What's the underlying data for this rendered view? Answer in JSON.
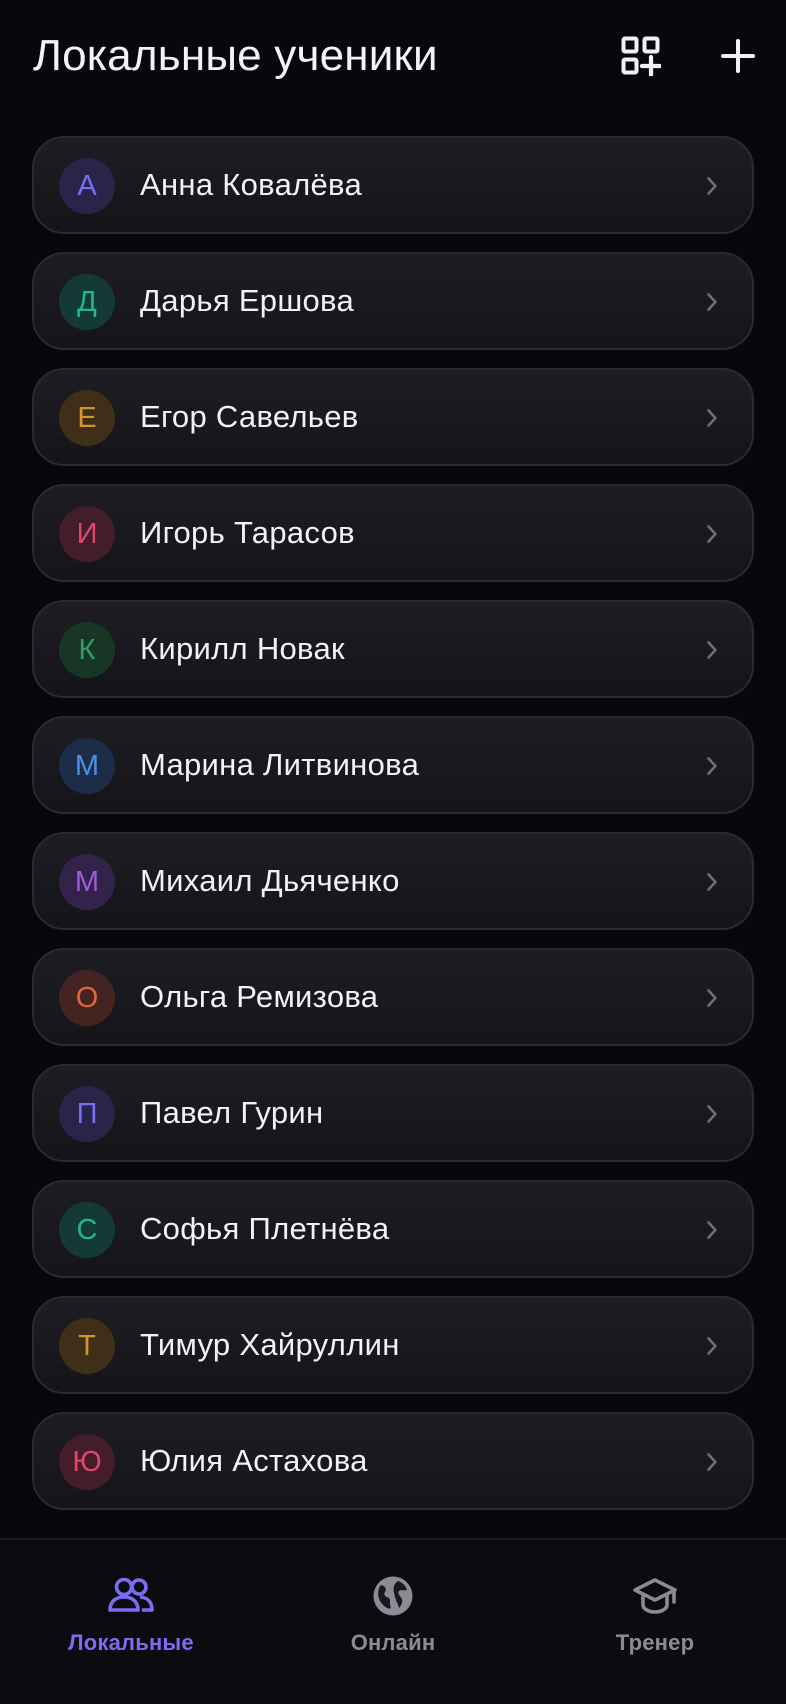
{
  "header": {
    "title": "Локальные ученики",
    "qr_icon": "qr-add-icon",
    "add_icon": "plus-icon"
  },
  "students": [
    {
      "initial": "А",
      "name": "Анна Ковалёва",
      "color": "#7c6cf0",
      "bg": "#29254a"
    },
    {
      "initial": "Д",
      "name": "Дарья Ершова",
      "color": "#1fb59a",
      "bg": "#143a35"
    },
    {
      "initial": "Е",
      "name": "Егор Савельев",
      "color": "#d4932c",
      "bg": "#3f2f18"
    },
    {
      "initial": "И",
      "name": "Игорь Тарасов",
      "color": "#e0466a",
      "bg": "#431d29"
    },
    {
      "initial": "К",
      "name": "Кирилл Новак",
      "color": "#2fa060",
      "bg": "#183626"
    },
    {
      "initial": "М",
      "name": "Марина Литвинова",
      "color": "#4c8ee8",
      "bg": "#1d2d48"
    },
    {
      "initial": "М",
      "name": "Михаил Дьяченко",
      "color": "#a25bd6",
      "bg": "#33224a"
    },
    {
      "initial": "О",
      "name": "Ольга Ремизова",
      "color": "#e0643c",
      "bg": "#432420"
    },
    {
      "initial": "П",
      "name": "Павел Гурин",
      "color": "#7c6cf0",
      "bg": "#29254a"
    },
    {
      "initial": "С",
      "name": "Софья Плетнёва",
      "color": "#1fb59a",
      "bg": "#143a35"
    },
    {
      "initial": "Т",
      "name": "Тимур Хайруллин",
      "color": "#d4932c",
      "bg": "#3f2f18"
    },
    {
      "initial": "Ю",
      "name": "Юлия Астахова",
      "color": "#e0466a",
      "bg": "#431d29"
    }
  ],
  "tabbar": {
    "tabs": [
      {
        "label": "Локальные",
        "icon": "users-icon",
        "active": true
      },
      {
        "label": "Онлайн",
        "icon": "globe-icon",
        "active": false
      },
      {
        "label": "Тренер",
        "icon": "graduation-cap-icon",
        "active": false
      }
    ],
    "active_color": "#7b6cf2",
    "inactive_color": "#8b8b95"
  }
}
